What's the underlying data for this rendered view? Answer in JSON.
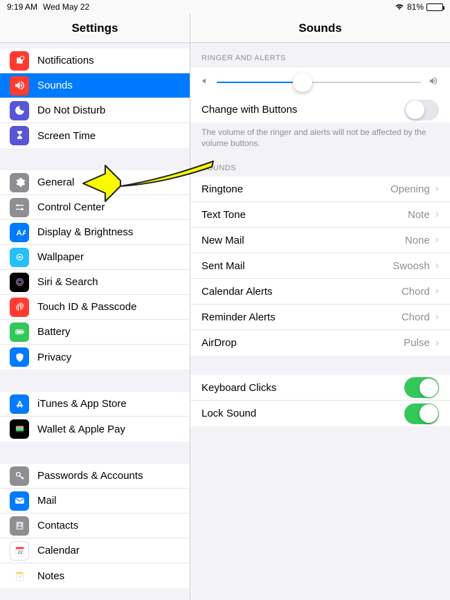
{
  "status": {
    "time": "9:19 AM",
    "date": "Wed May 22",
    "battery_pct": "81%"
  },
  "sidebar": {
    "title": "Settings",
    "groups": [
      [
        "Notifications",
        "Sounds",
        "Do Not Disturb",
        "Screen Time"
      ],
      [
        "General",
        "Control Center",
        "Display & Brightness",
        "Wallpaper",
        "Siri & Search",
        "Touch ID & Passcode",
        "Battery",
        "Privacy"
      ],
      [
        "iTunes & App Store",
        "Wallet & Apple Pay"
      ],
      [
        "Passwords & Accounts",
        "Mail",
        "Contacts",
        "Calendar",
        "Notes"
      ]
    ],
    "selected": "Sounds"
  },
  "content": {
    "title": "Sounds",
    "ringer_header": "RINGER AND ALERTS",
    "change_buttons_label": "Change with Buttons",
    "change_buttons_on": false,
    "ringer_footer": "The volume of the ringer and alerts will not be affected by the volume buttons.",
    "volume_pct": 42,
    "sounds_header": "SOUNDS",
    "sound_rows": [
      {
        "label": "Ringtone",
        "value": "Opening"
      },
      {
        "label": "Text Tone",
        "value": "Note"
      },
      {
        "label": "New Mail",
        "value": "None"
      },
      {
        "label": "Sent Mail",
        "value": "Swoosh"
      },
      {
        "label": "Calendar Alerts",
        "value": "Chord"
      },
      {
        "label": "Reminder Alerts",
        "value": "Chord"
      },
      {
        "label": "AirDrop",
        "value": "Pulse"
      }
    ],
    "toggles": [
      {
        "label": "Keyboard Clicks",
        "on": true
      },
      {
        "label": "Lock Sound",
        "on": true
      }
    ]
  }
}
